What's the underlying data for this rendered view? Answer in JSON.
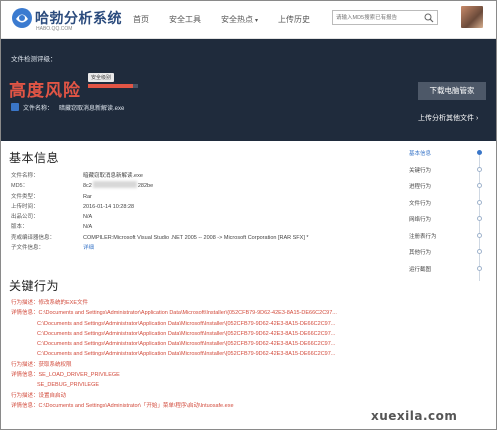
{
  "header": {
    "logo_text": "哈勃分析系统",
    "logo_sub": "HABO.QQ.COM",
    "nav": [
      {
        "label": "首页"
      },
      {
        "label": "安全工具"
      },
      {
        "label": "安全热点",
        "dropdown": true
      },
      {
        "label": "上传历史"
      }
    ],
    "search_placeholder": "请输入MD5搜索已有报告"
  },
  "hero": {
    "label": "文件检测评级：",
    "risk_text": "高度风险",
    "risk_badge": "安全级别",
    "risk_level_fraction": 0.9,
    "file_label": "文件名称：",
    "file_name": "暗藏窃取消息新解读.exe",
    "download_button": "下载电脑管家",
    "upload_link": "上传分析其他文件 ›",
    "risk_color": "#e25545"
  },
  "basic_info": {
    "title": "基本信息",
    "rows": [
      {
        "key": "文件名称：",
        "val": "暗藏窃取消息新解读.exe"
      },
      {
        "key": "MD5：",
        "val_prefix": "8c2",
        "val_suffix": "282be",
        "redacted": true
      },
      {
        "key": "文件类型：",
        "val": "Rar"
      },
      {
        "key": "上传时间：",
        "val": "2016-01-14 10:28:28"
      },
      {
        "key": "出品公司：",
        "val": "N/A"
      },
      {
        "key": "版本：",
        "val": "N/A"
      },
      {
        "key": "壳或编译器信息：",
        "val": "COMPILER:Microsoft Visual Studio .NET 2005 -- 2008 -> Microsoft Corporation [RAR SFX] *"
      },
      {
        "key": "子文件信息：",
        "val": "详细",
        "link": true
      }
    ]
  },
  "key_behavior": {
    "title": "关键行为",
    "lines": [
      {
        "text": "行为描述：修改系统的EXE文件",
        "sub": false
      },
      {
        "text": "详情信息：C:\\Documents and Settings\\Administrator\\Application Data\\Microsoft\\Installer\\{052CFB79-9D62-42E3-8A15-DE66C2C97...",
        "sub": false
      },
      {
        "text": "C:\\Documents and Settings\\Administrator\\Application Data\\Microsoft\\Installer\\{052CFB79-9D62-42E3-8A15-DE66C2C97...",
        "sub": true
      },
      {
        "text": "C:\\Documents and Settings\\Administrator\\Application Data\\Microsoft\\Installer\\{052CFB79-9D62-42E3-8A15-DE66C2C97...",
        "sub": true
      },
      {
        "text": "C:\\Documents and Settings\\Administrator\\Application Data\\Microsoft\\Installer\\{052CFB79-9D62-42E3-8A15-DE66C2C97...",
        "sub": true
      },
      {
        "text": "C:\\Documents and Settings\\Administrator\\Application Data\\Microsoft\\Installer\\{052CFB79-9D62-42E3-8A15-DE66C2C97...",
        "sub": true
      },
      {
        "text": "行为描述：获取系统权限",
        "sub": false
      },
      {
        "text": "详情信息：SE_LOAD_DRIVER_PRIVILEGE",
        "sub": false
      },
      {
        "text": "SE_DEBUG_PRIVILEGE",
        "sub": true
      },
      {
        "text": "行为描述：设置自启动",
        "sub": false
      },
      {
        "text": "详情信息：C:\\Documents and Settings\\Administrator\\「开始」菜单\\程序\\启动\\Intuosafe.exe",
        "sub": false
      }
    ]
  },
  "sidebar": {
    "items": [
      {
        "label": "基本信息",
        "active": true
      },
      {
        "label": "关键行为",
        "active": false
      },
      {
        "label": "进程行为",
        "active": false
      },
      {
        "label": "文件行为",
        "active": false
      },
      {
        "label": "网络行为",
        "active": false
      },
      {
        "label": "注册表行为",
        "active": false
      },
      {
        "label": "其他行为",
        "active": false
      },
      {
        "label": "运行截图",
        "active": false
      }
    ]
  },
  "watermark": "xuexila.com"
}
